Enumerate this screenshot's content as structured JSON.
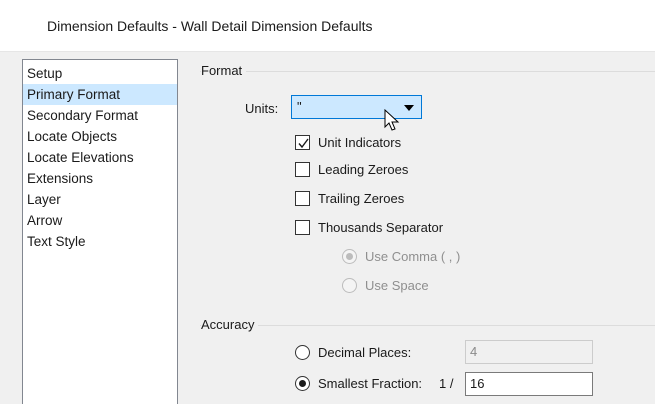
{
  "window": {
    "title": "Dimension Defaults - Wall Detail Dimension Defaults"
  },
  "sidebar": {
    "items": [
      {
        "label": "Setup",
        "selected": false
      },
      {
        "label": "Primary Format",
        "selected": true
      },
      {
        "label": "Secondary Format",
        "selected": false
      },
      {
        "label": "Locate Objects",
        "selected": false
      },
      {
        "label": "Locate Elevations",
        "selected": false
      },
      {
        "label": "Extensions",
        "selected": false
      },
      {
        "label": "Layer",
        "selected": false
      },
      {
        "label": "Arrow",
        "selected": false
      },
      {
        "label": "Text Style",
        "selected": false
      }
    ]
  },
  "format": {
    "group_label": "Format",
    "units_label": "Units:",
    "units_value": "\"",
    "unit_indicators": {
      "label": "Unit Indicators",
      "checked": true
    },
    "leading_zeroes": {
      "label": "Leading Zeroes",
      "checked": false
    },
    "trailing_zeroes": {
      "label": "Trailing Zeroes",
      "checked": false
    },
    "thousands_separator": {
      "label": "Thousands Separator",
      "checked": false
    },
    "use_comma": {
      "label": "Use Comma ( , )",
      "selected": true,
      "enabled": false
    },
    "use_space": {
      "label": "Use Space",
      "selected": false,
      "enabled": false
    }
  },
  "accuracy": {
    "group_label": "Accuracy",
    "decimal_places": {
      "label": "Decimal Places:",
      "value": "4",
      "selected": false,
      "enabled": false
    },
    "smallest_fraction": {
      "label": "Smallest Fraction:",
      "prefix": "1 /",
      "value": "16",
      "selected": true
    }
  },
  "colors": {
    "selection": "#cce8ff",
    "focus_border": "#0078d7",
    "dialog_bg": "#f0f0f0"
  }
}
